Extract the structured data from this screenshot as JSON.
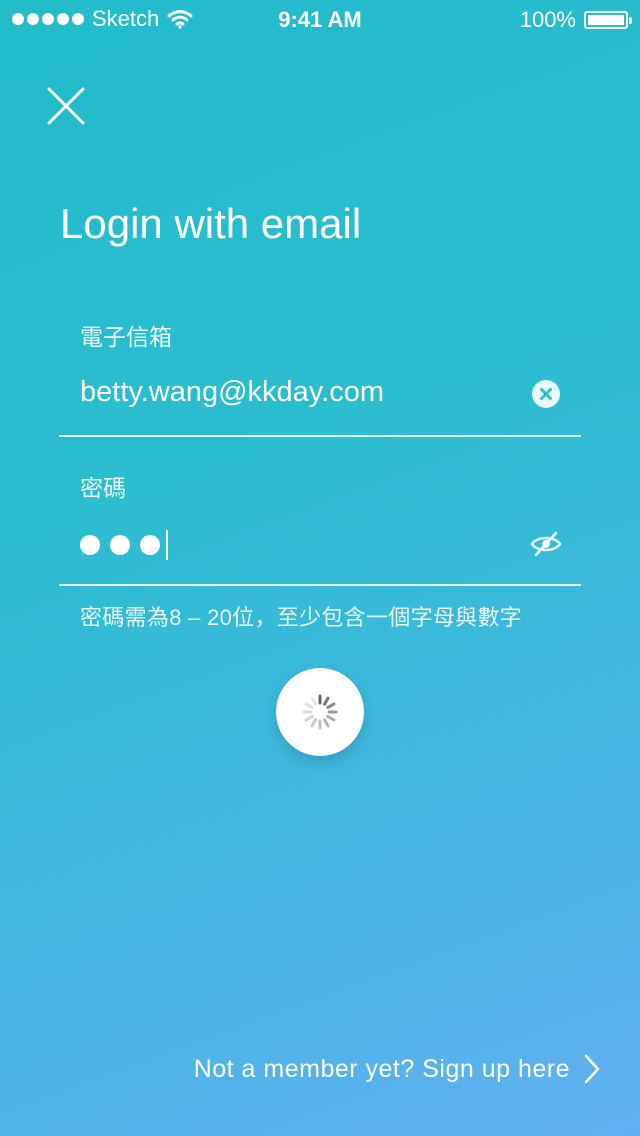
{
  "status_bar": {
    "carrier": "Sketch",
    "time": "9:41 AM",
    "battery": "100%"
  },
  "page": {
    "title": "Login with email"
  },
  "form": {
    "email_label": "電子信箱",
    "email_value": "betty.wang@kkday.com",
    "password_label": "密碼",
    "password_hint": "密碼需為8 – 20位，至少包含一個字母與數字"
  },
  "footer": {
    "signup_text": "Not a member yet? Sign up here"
  },
  "icons": {
    "close": "close-icon",
    "clear": "clear-icon",
    "eye": "eye-slash-icon",
    "spinner": "spinner-icon",
    "chevron": "chevron-right-icon"
  }
}
